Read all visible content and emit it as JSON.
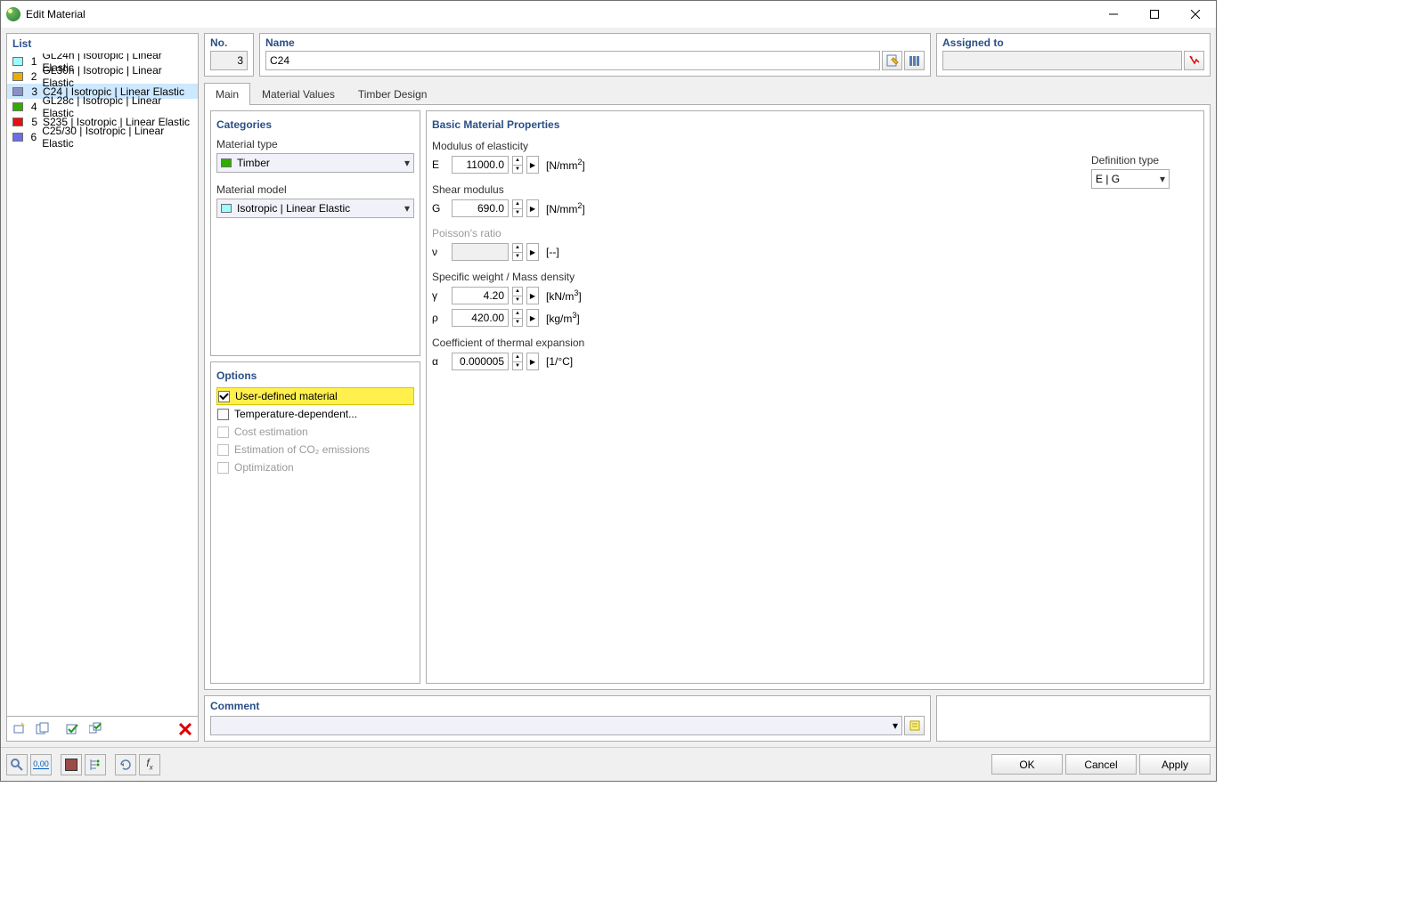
{
  "window": {
    "title": "Edit Material"
  },
  "list": {
    "header": "List",
    "items": [
      {
        "num": "1",
        "label": "GL24h | Isotropic | Linear Elastic",
        "color": "#99FFFF"
      },
      {
        "num": "2",
        "label": "GL30h | Isotropic | Linear Elastic",
        "color": "#E8AE00"
      },
      {
        "num": "3",
        "label": "C24 | Isotropic | Linear Elastic",
        "color": "#8A8FC8",
        "selected": true
      },
      {
        "num": "4",
        "label": "GL28c | Isotropic | Linear Elastic",
        "color": "#2FAE00"
      },
      {
        "num": "5",
        "label": "S235 | Isotropic | Linear Elastic",
        "color": "#E80F0F"
      },
      {
        "num": "6",
        "label": "C25/30 | Isotropic | Linear Elastic",
        "color": "#6A6FE6"
      }
    ]
  },
  "header": {
    "no_label": "No.",
    "no_value": "3",
    "name_label": "Name",
    "name_value": "C24",
    "assigned_label": "Assigned to",
    "assigned_value": ""
  },
  "tabs": {
    "t0": "Main",
    "t1": "Material Values",
    "t2": "Timber Design",
    "active": 0
  },
  "categories": {
    "header": "Categories",
    "type_label": "Material type",
    "type_value": "Timber",
    "type_color": "#2FAE00",
    "model_label": "Material model",
    "model_value": "Isotropic | Linear Elastic",
    "model_color": "#99FFFF"
  },
  "options": {
    "header": "Options",
    "opt0": {
      "label": "User-defined material",
      "checked": true,
      "enabled": true,
      "highlight": true
    },
    "opt1": {
      "label": "Temperature-dependent...",
      "checked": false,
      "enabled": true
    },
    "opt2": {
      "label": "Cost estimation",
      "checked": false,
      "enabled": false
    },
    "opt3": {
      "label": "Estimation of CO₂ emissions",
      "checked": false,
      "enabled": false
    },
    "opt4": {
      "label": "Optimization",
      "checked": false,
      "enabled": false
    }
  },
  "props": {
    "header": "Basic Material Properties",
    "modulus_label": "Modulus of elasticity",
    "E": {
      "sym": "E",
      "val": "11000.0",
      "unit_html": "[N/mm<sup>2</sup>]"
    },
    "shear_label": "Shear modulus",
    "G": {
      "sym": "G",
      "val": "690.0",
      "unit_html": "[N/mm<sup>2</sup>]"
    },
    "poisson_label": "Poisson's ratio",
    "nu": {
      "sym": "ν",
      "val": "",
      "unit_html": "[--]",
      "disabled": true
    },
    "weight_label": "Specific weight / Mass density",
    "gamma": {
      "sym": "γ",
      "val": "4.20",
      "unit_html": "[kN/m<sup>3</sup>]"
    },
    "rho": {
      "sym": "ρ",
      "val": "420.00",
      "unit_html": "[kg/m<sup>3</sup>]"
    },
    "thermal_label": "Coefficient of thermal expansion",
    "alpha": {
      "sym": "α",
      "val": "0.000005",
      "unit_html": "[1/°C]"
    },
    "deftype_label": "Definition type",
    "deftype_value": "E | G"
  },
  "comment": {
    "header": "Comment",
    "value": ""
  },
  "buttons": {
    "ok": "OK",
    "cancel": "Cancel",
    "apply": "Apply"
  }
}
